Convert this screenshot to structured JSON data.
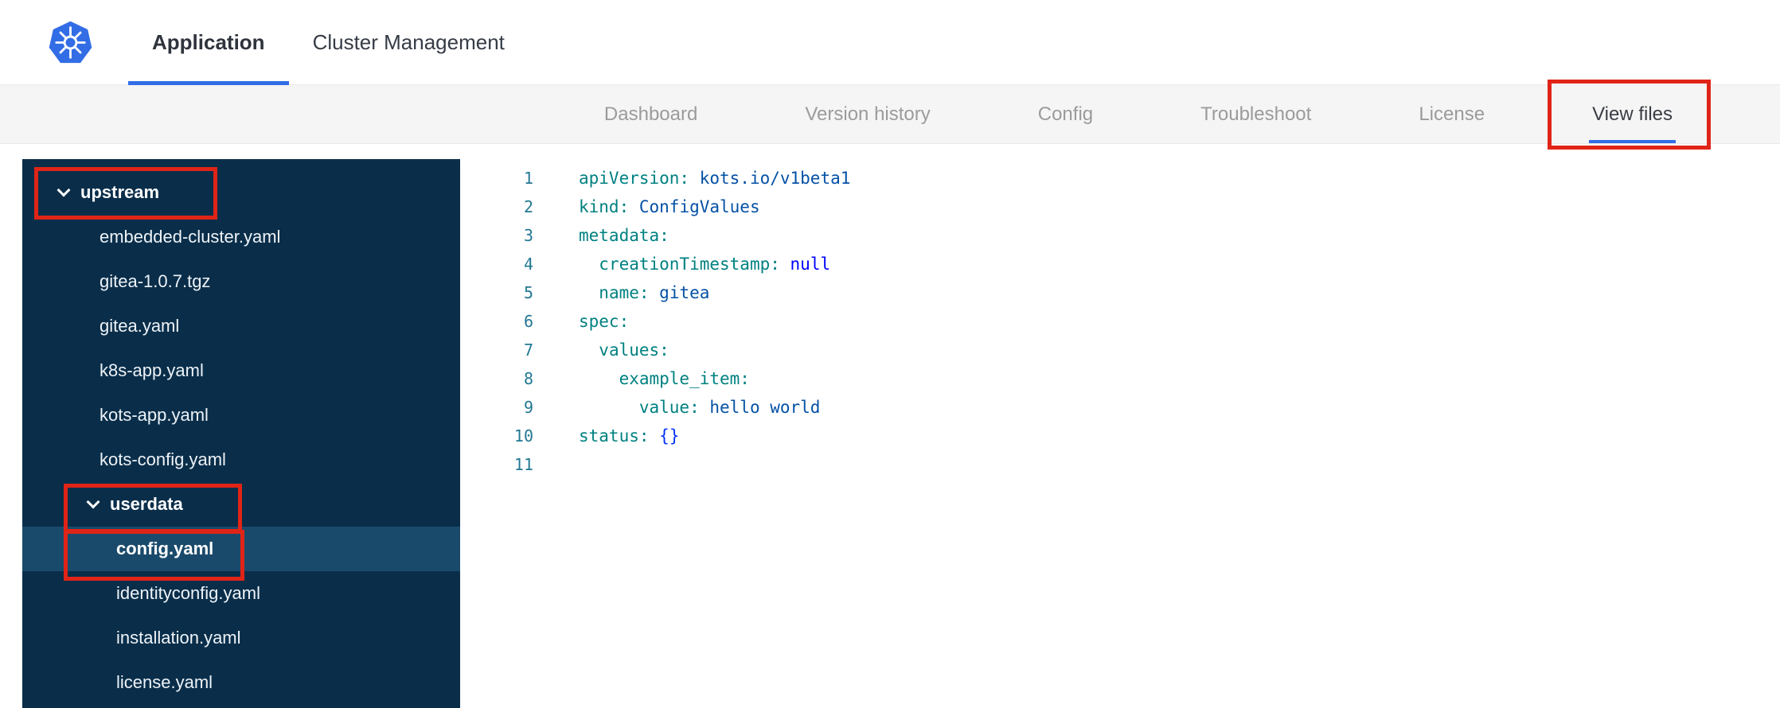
{
  "header": {
    "logo_icon": "kubernetes-logo",
    "tabs": [
      {
        "label": "Application",
        "active": true
      },
      {
        "label": "Cluster Management",
        "active": false
      }
    ]
  },
  "subnav": {
    "tabs": [
      {
        "label": "Dashboard",
        "active": false
      },
      {
        "label": "Version history",
        "active": false
      },
      {
        "label": "Config",
        "active": false
      },
      {
        "label": "Troubleshoot",
        "active": false
      },
      {
        "label": "License",
        "active": false
      },
      {
        "label": "View files",
        "active": true
      }
    ]
  },
  "file_tree": {
    "items": [
      {
        "label": "upstream",
        "type": "folder",
        "expanded": true,
        "level": 0,
        "selected": false
      },
      {
        "label": "embedded-cluster.yaml",
        "type": "file",
        "level": 1,
        "selected": false
      },
      {
        "label": "gitea-1.0.7.tgz",
        "type": "file",
        "level": 1,
        "selected": false
      },
      {
        "label": "gitea.yaml",
        "type": "file",
        "level": 1,
        "selected": false
      },
      {
        "label": "k8s-app.yaml",
        "type": "file",
        "level": 1,
        "selected": false
      },
      {
        "label": "kots-app.yaml",
        "type": "file",
        "level": 1,
        "selected": false
      },
      {
        "label": "kots-config.yaml",
        "type": "file",
        "level": 1,
        "selected": false
      },
      {
        "label": "userdata",
        "type": "folder",
        "expanded": true,
        "level": 1,
        "selected": false
      },
      {
        "label": "config.yaml",
        "type": "file",
        "level": 2,
        "selected": true
      },
      {
        "label": "identityconfig.yaml",
        "type": "file",
        "level": 2,
        "selected": false
      },
      {
        "label": "installation.yaml",
        "type": "file",
        "level": 2,
        "selected": false
      },
      {
        "label": "license.yaml",
        "type": "file",
        "level": 2,
        "selected": false
      }
    ]
  },
  "editor": {
    "language": "yaml",
    "lines": [
      {
        "num": "1",
        "tokens": [
          {
            "c": "key",
            "t": "apiVersion:"
          },
          {
            "c": "plain",
            "t": " "
          },
          {
            "c": "str",
            "t": "kots.io/v1beta1"
          }
        ]
      },
      {
        "num": "2",
        "tokens": [
          {
            "c": "key",
            "t": "kind:"
          },
          {
            "c": "plain",
            "t": " "
          },
          {
            "c": "str",
            "t": "ConfigValues"
          }
        ]
      },
      {
        "num": "3",
        "tokens": [
          {
            "c": "key",
            "t": "metadata:"
          }
        ]
      },
      {
        "num": "4",
        "tokens": [
          {
            "c": "plain",
            "t": "  "
          },
          {
            "c": "key",
            "t": "creationTimestamp:"
          },
          {
            "c": "plain",
            "t": " "
          },
          {
            "c": "kw",
            "t": "null"
          }
        ]
      },
      {
        "num": "5",
        "tokens": [
          {
            "c": "plain",
            "t": "  "
          },
          {
            "c": "key",
            "t": "name:"
          },
          {
            "c": "plain",
            "t": " "
          },
          {
            "c": "str",
            "t": "gitea"
          }
        ]
      },
      {
        "num": "6",
        "tokens": [
          {
            "c": "key",
            "t": "spec:"
          }
        ]
      },
      {
        "num": "7",
        "tokens": [
          {
            "c": "plain",
            "t": "  "
          },
          {
            "c": "key",
            "t": "values:"
          }
        ]
      },
      {
        "num": "8",
        "tokens": [
          {
            "c": "plain",
            "t": "    "
          },
          {
            "c": "key",
            "t": "example_item:"
          }
        ]
      },
      {
        "num": "9",
        "tokens": [
          {
            "c": "plain",
            "t": "      "
          },
          {
            "c": "key",
            "t": "value:"
          },
          {
            "c": "plain",
            "t": " "
          },
          {
            "c": "str",
            "t": "hello world"
          }
        ]
      },
      {
        "num": "10",
        "tokens": [
          {
            "c": "key",
            "t": "status:"
          },
          {
            "c": "plain",
            "t": " "
          },
          {
            "c": "brace",
            "t": "{}"
          }
        ]
      },
      {
        "num": "11",
        "tokens": []
      }
    ]
  },
  "annotations": [
    {
      "target": "view-files-tab"
    },
    {
      "target": "upstream-folder"
    },
    {
      "target": "userdata-folder"
    },
    {
      "target": "config-yaml-file"
    }
  ],
  "colors": {
    "accent_blue": "#326de6",
    "annotation_red": "#e02417",
    "sidebar_bg": "#0a2e4a",
    "sidebar_selected_bg": "#1a4a6b",
    "subnav_bg": "#f5f5f5",
    "code_key": "#008080",
    "code_string": "#0451a5",
    "code_keyword": "#0000ff",
    "code_brace": "#0431fa",
    "code_line_number": "#237893"
  }
}
